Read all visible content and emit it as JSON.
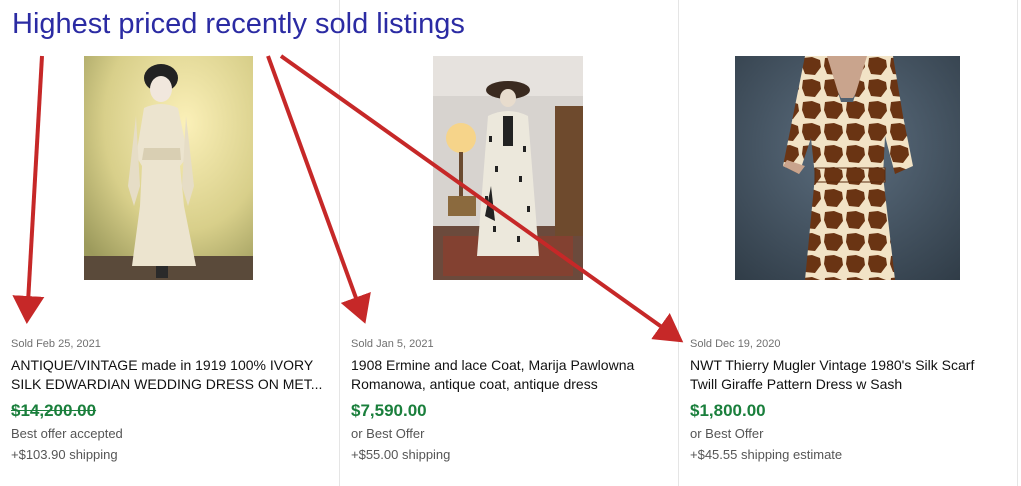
{
  "heading": "Highest priced recently sold listings",
  "listings": [
    {
      "sold": "Sold Feb 25, 2021",
      "title_line1": "ANTIQUE/VINTAGE made in 1919 100% IVORY",
      "title_line2": "SILK EDWARDIAN WEDDING DRESS ON MET...",
      "price": "$14,200.00",
      "offer": "Best offer accepted",
      "shipping": "+$103.90 shipping",
      "image": "ivory-dress-mannequin-photo"
    },
    {
      "sold": "Sold Jan 5, 2021",
      "title_line1": "1908 Ermine and lace Coat, Marija Pawlowna",
      "title_line2": "Romanowa, antique coat, antique dress",
      "price": "$7,590.00",
      "offer": "or Best Offer",
      "shipping": "+$55.00 shipping",
      "image": "ermine-coat-mannequin-photo"
    },
    {
      "sold": "Sold Dec 19, 2020",
      "title_line1": "NWT Thierry Mugler Vintage 1980's Silk Scarf",
      "title_line2": "Twill Giraffe Pattern Dress w Sash",
      "price": "$1,800.00",
      "offer": "or Best Offer",
      "shipping": "+$45.55 shipping estimate",
      "image": "giraffe-print-dress-photo"
    }
  ],
  "colors": {
    "heading": "#2b2ba3",
    "price": "#1a7f3c",
    "arrow": "#c62828"
  }
}
